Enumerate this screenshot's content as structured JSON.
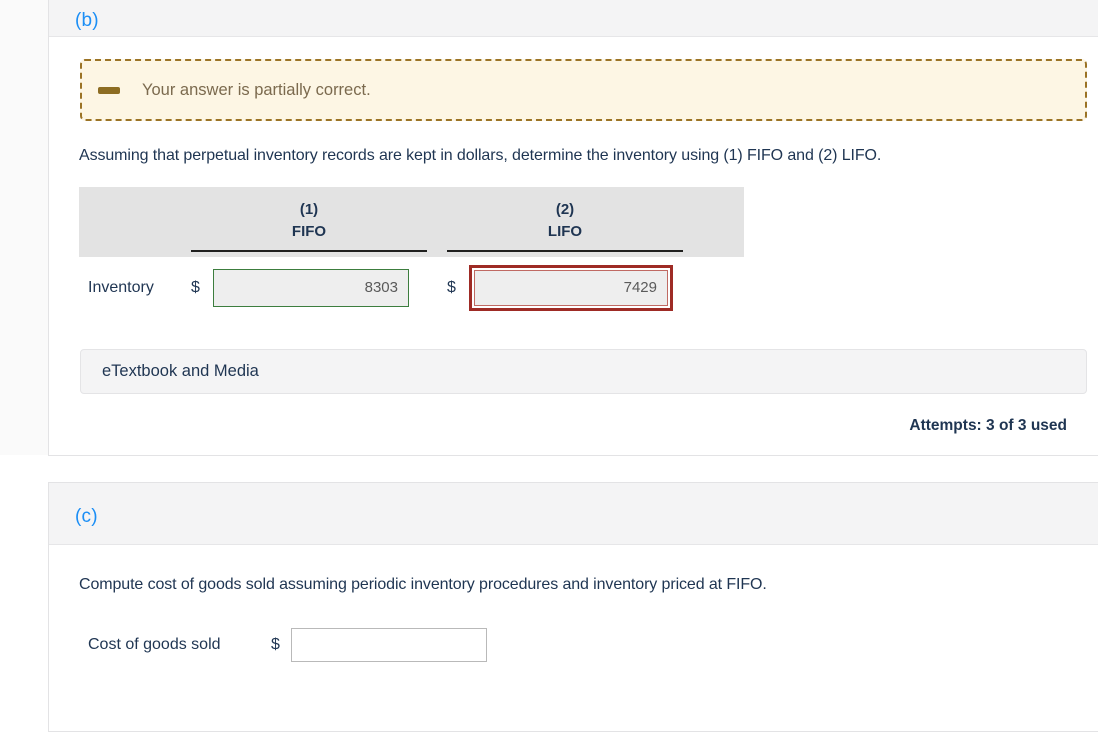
{
  "sections": [
    {
      "part_label": "(b)",
      "alert": {
        "icon": "minus-dash-icon",
        "message": "Your answer is partially correct.",
        "background": "#fdf6e4",
        "border_color": "#9b7325",
        "icon_color": "#8d6d22",
        "text_color": "#7b6a4e"
      },
      "question": "Assuming that perpetual inventory records are kept in dollars, determine the inventory using (1) FIFO and (2) LIFO.",
      "table": {
        "columns": [
          {
            "number": "(1)",
            "name": "FIFO"
          },
          {
            "number": "(2)",
            "name": "LIFO"
          }
        ],
        "row_label": "Inventory",
        "currency_symbol": "$",
        "cells": [
          {
            "value": "8303",
            "state": "correct",
            "border_color": "#3c7d3e"
          },
          {
            "value": "7429",
            "state": "incorrect",
            "border_color": "#9e2b25"
          }
        ]
      },
      "etextbook_label": "eTextbook and Media",
      "attempts": "Attempts: 3 of 3 used"
    },
    {
      "part_label": "(c)",
      "question": "Compute cost of goods sold assuming periodic inventory procedures and inventory priced at FIFO.",
      "cogs": {
        "label": "Cost of goods sold",
        "currency_symbol": "$",
        "value": "",
        "placeholder": ""
      }
    }
  ],
  "colors": {
    "part_label": "#1b8ef5",
    "text": "#1f3552",
    "header_band": "#f4f4f5",
    "table_header": "#e3e3e3"
  }
}
